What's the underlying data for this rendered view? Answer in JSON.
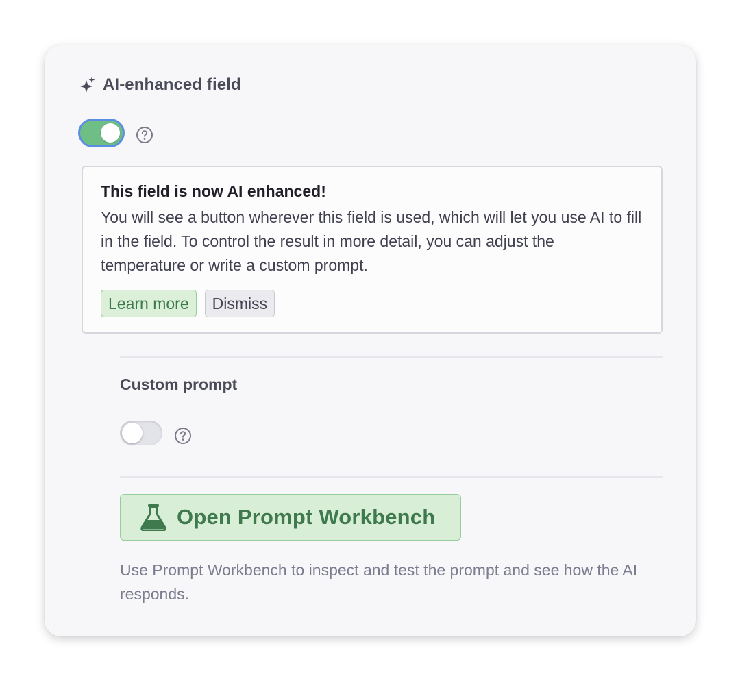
{
  "field": {
    "icon": "sparkle-icon",
    "title": "AI-enhanced field",
    "ai_enabled": true
  },
  "notice": {
    "title": "This field is now AI enhanced!",
    "body": "You will see a button wherever this field is used, which will let you use AI to fill in the field. To control the result in more detail, you can adjust the temperature or write a custom prompt.",
    "learn_more_label": "Learn more",
    "dismiss_label": "Dismiss"
  },
  "custom_prompt": {
    "title": "Custom prompt",
    "enabled": false
  },
  "workbench": {
    "icon": "flask-icon",
    "button_label": "Open Prompt Workbench",
    "description": "Use Prompt Workbench to inspect and test the prompt and see how the AI responds."
  },
  "colors": {
    "toggle_on": "#6fbe86",
    "focus_ring": "#5b8ee0",
    "accent_green_text": "#3f7a4f",
    "accent_green_bg": "#d9eed7"
  }
}
